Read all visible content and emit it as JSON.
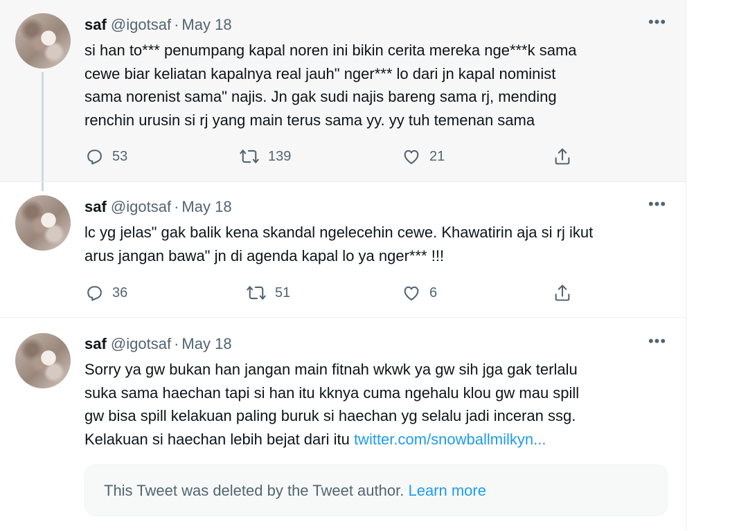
{
  "tweets": [
    {
      "name": "saf",
      "handle": "@igotsaf",
      "separator": "·",
      "date": "May 18",
      "lines": [
        "si han to*** penumpang kapal noren ini bikin cerita mereka nge***k sama",
        "cewe biar keliatan kapalnya real jauh\" nger***  lo dari jn kapal nominist",
        "sama norenist sama\" najis. Jn gak sudi najis bareng sama rj, mending",
        "renchin urusin si rj yang main terus sama yy. yy tuh temenan sama"
      ],
      "replies": "53",
      "retweets": "139",
      "likes": "21"
    },
    {
      "name": "saf",
      "handle": "@igotsaf",
      "separator": "·",
      "date": "May 18",
      "lines": [
        "lc yg jelas\" gak balik kena skandal ngelecehin cewe. Khawatirin aja si rj ikut",
        "arus jangan bawa\" jn di agenda kapal lo ya nger***   !!!"
      ],
      "replies": "36",
      "retweets": "51",
      "likes": "6"
    },
    {
      "name": "saf",
      "handle": "@igotsaf",
      "separator": "·",
      "date": "May 18",
      "lines": [
        "Sorry ya gw bukan han jangan main fitnah wkwk ya gw sih jga gak terlalu",
        "suka sama haechan tapi si han itu kknya cuma ngehalu klou gw mau spill",
        "gw bisa spill kelakuan paling buruk si haechan yg selalu jadi inceran ssg."
      ],
      "last_line_text": "Kelakuan si haechan lebih bejat dari itu ",
      "link": "twitter.com/snowballmilkyn...",
      "deleted_notice": "This Tweet was deleted by the Tweet author.",
      "learn_more": "Learn more"
    }
  ],
  "more_glyph": "•••",
  "colors": {
    "accent": "#1d9bf0",
    "secondary_text": "#536471",
    "primary_text": "#0f1419",
    "highlighted_bg": "#f7f7f7"
  },
  "icons": [
    "reply-icon",
    "retweet-icon",
    "like-icon",
    "share-icon",
    "more-icon"
  ]
}
